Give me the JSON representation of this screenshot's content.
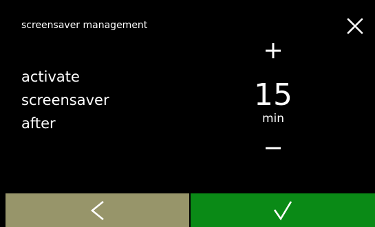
{
  "header": {
    "title": "screensaver management"
  },
  "setting": {
    "label_lines": [
      "activate",
      "screensaver",
      "after"
    ],
    "value": "15",
    "unit": "min"
  },
  "icons": {
    "close": "close-icon",
    "increase": "plus-icon",
    "decrease": "minus-icon",
    "back": "chevron-left-icon",
    "confirm": "checkmark-icon"
  },
  "colors": {
    "background": "#000000",
    "text": "#ffffff",
    "back_button": "#97956a",
    "confirm_button": "#0a8a16"
  }
}
